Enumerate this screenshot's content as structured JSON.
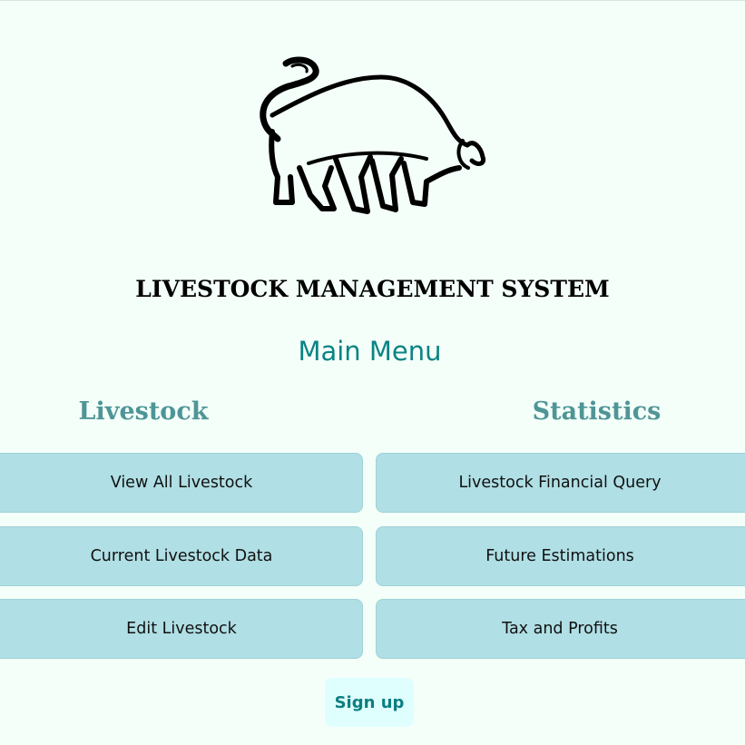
{
  "app": {
    "title": "LIVESTOCK MANAGEMENT SYSTEM",
    "logo_icon": "bull-icon"
  },
  "main_menu": {
    "title": "Main Menu"
  },
  "sections": {
    "livestock": {
      "title": "Livestock",
      "buttons": [
        {
          "label": "View All Livestock"
        },
        {
          "label": "Current Livestock Data"
        },
        {
          "label": "Edit Livestock"
        }
      ]
    },
    "statistics": {
      "title": "Statistics",
      "buttons": [
        {
          "label": "Livestock Financial Query"
        },
        {
          "label": "Future Estimations"
        },
        {
          "label": "Tax and Profits"
        }
      ]
    }
  },
  "signup": {
    "label": "Sign up"
  },
  "colors": {
    "background": "#f4fff9",
    "button": "#b0dfe5",
    "accent": "#0b8484",
    "section_title": "#4f9597",
    "signup_bg": "#dffffe"
  }
}
